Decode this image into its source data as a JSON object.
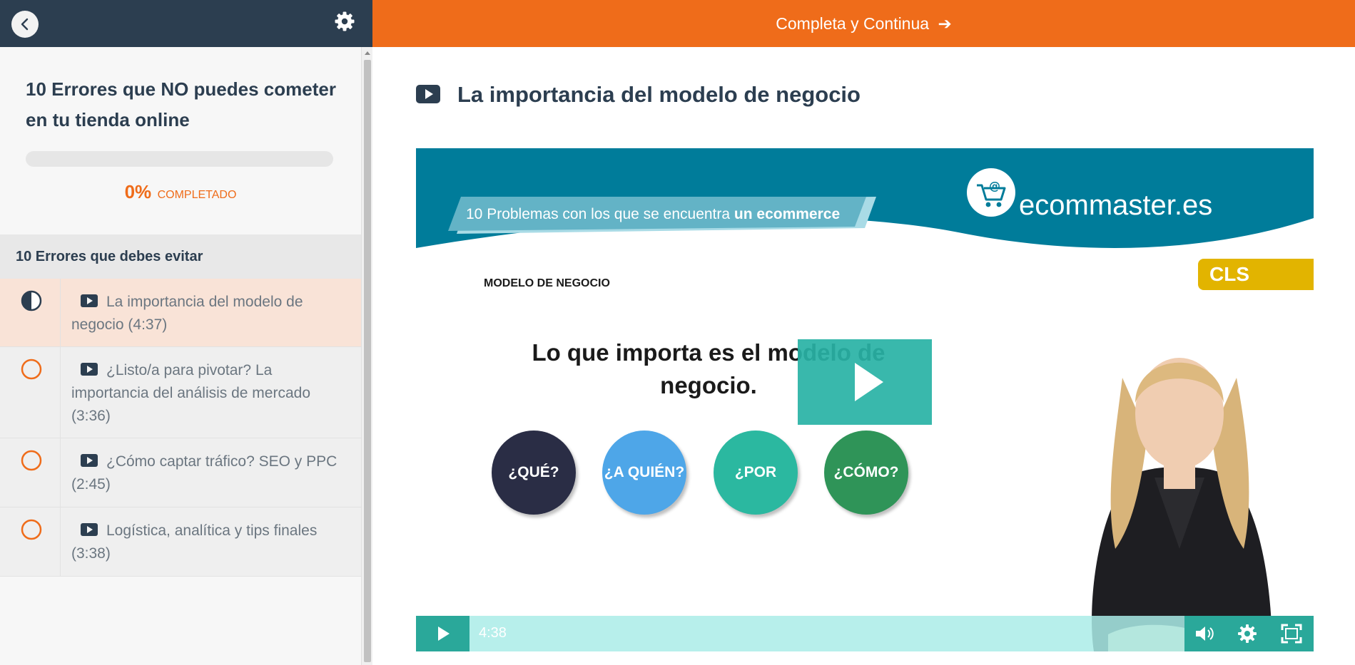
{
  "sidebar": {
    "course_title": "10 Errores que NO puedes cometer en tu tienda online",
    "progress": {
      "percent": 0,
      "percent_label": "0%",
      "label": "COMPLETADO"
    },
    "section_title": "10 Errores que debes evitar",
    "lessons": [
      {
        "title": "La importancia del modelo de negocio (4:37)",
        "status": "in-progress",
        "active": true
      },
      {
        "title": "¿Listo/a para pivotar? La importancia del análisis de mercado (3:36)",
        "status": "not-started",
        "active": false
      },
      {
        "title": "¿Cómo captar tráfico? SEO y PPC (2:45)",
        "status": "not-started",
        "active": false
      },
      {
        "title": "Logística, analítica y tips finales (3:38)",
        "status": "not-started",
        "active": false
      }
    ]
  },
  "topbar": {
    "complete_label": "Completa y Continua",
    "arrow": "➔"
  },
  "lecture": {
    "title": "La importancia del modelo de negocio",
    "video": {
      "slide_tag_prefix": "10 Problemas con los que se encuentra ",
      "slide_tag_bold": "un ecommerce",
      "logo_text": "ecommaster.es",
      "badge": "CLS",
      "section": "MODELO DE NEGOCIO",
      "headline": "Lo que importa es el modelo de negocio.",
      "questions": [
        {
          "label": "¿QUÉ?",
          "color": "#2a2d45"
        },
        {
          "label": "¿A QUIÉN?",
          "color": "#4ea6e8"
        },
        {
          "label": "¿POR QUÉ?",
          "color": "#2bb8a0"
        },
        {
          "label": "¿CÓMO?",
          "color": "#2f9458"
        }
      ],
      "duration": "4:38"
    }
  },
  "colors": {
    "accent": "#ef6c1a",
    "navy": "#2c3e50",
    "teal": "#2aa89a",
    "slide_header": "#007c9a"
  }
}
